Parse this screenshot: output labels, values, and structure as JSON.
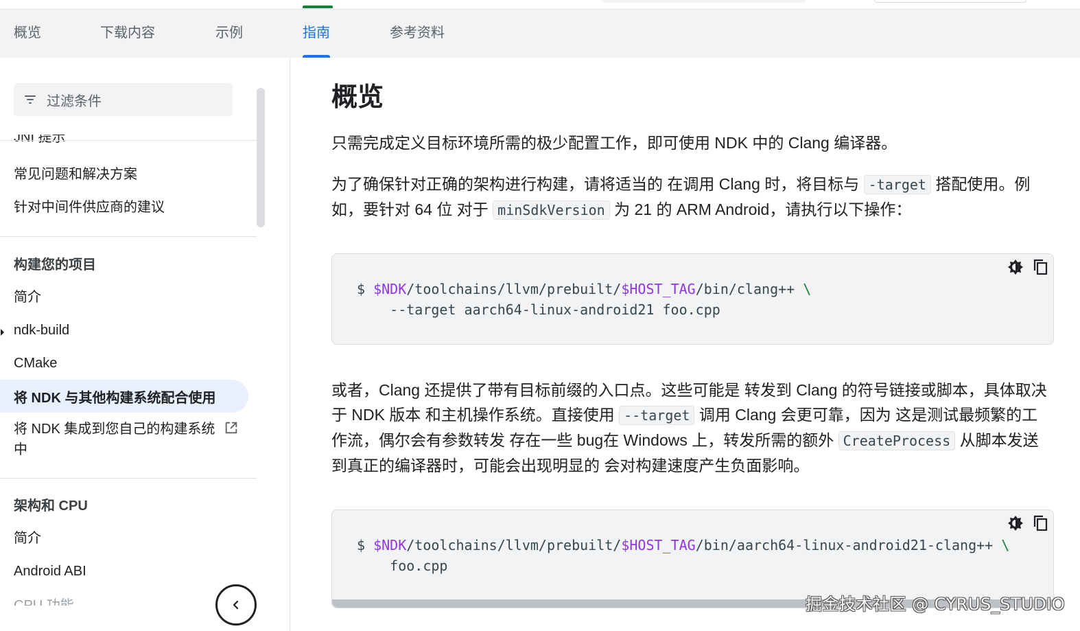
{
  "tabs": [
    {
      "label": "概览"
    },
    {
      "label": "下载内容"
    },
    {
      "label": "示例"
    },
    {
      "label": "指南"
    },
    {
      "label": "参考资料"
    }
  ],
  "active_tab": "指南",
  "sidebar": {
    "filter_label": "过滤条件",
    "cut_item": "JNI 提示",
    "items_top": [
      "常见问题和解决方案",
      "针对中间件供应商的建议"
    ],
    "section1": {
      "heading": "构建您的项目",
      "items": [
        "简介",
        "ndk-build",
        "CMake"
      ],
      "active": "将 NDK 与其他构建系统配合使用",
      "external": "将 NDK 集成到您自己的构建系统中"
    },
    "section2": {
      "heading": "架构和 CPU",
      "items": [
        "简介",
        "Android ABI"
      ],
      "cut_item": "CPU 功能"
    }
  },
  "main": {
    "title": "概览",
    "p1": "只需完成定义目标环境所需的极少配置工作，即可使用 NDK 中的 Clang 编译器。",
    "p2a": "为了确保针对正确的架构进行构建，请将适当的 在调用 Clang 时，将目标与 ",
    "p2code1": "-target",
    "p2b": " 搭配使用。例如，要针对 64 位 对于 ",
    "p2code2": "minSdkVersion",
    "p2c": " 为 21 的 ARM Android，请执行以下操作：",
    "code1": {
      "prompt": "$ ",
      "v1": "$NDK",
      "s1": "/toolchains/llvm/prebuilt/",
      "v2": "$HOST_TAG",
      "s2": "/bin/clang++ ",
      "esc": "\\",
      "line2": "    --target aarch64-linux-android21 foo.cpp"
    },
    "p3a": "或者，Clang 还提供了带有目标前缀的入口点。这些可能是 转发到 Clang 的符号链接或脚本，具体取决于 NDK 版本 和主机操作系统。直接使用 ",
    "p3code1": "--target",
    "p3b": " 调用 Clang 会更可靠，因为 这是测试最频繁的工作流，偶尔会有参数转发 存在一些 bug在 Windows 上，转发所需的额外 ",
    "p3code2": "CreateProcess",
    "p3c": " 从脚本发送到真正的编译器时，可能会出现明显的 会对构建速度产生负面影响。",
    "code2": {
      "prompt": "$ ",
      "v1": "$NDK",
      "s1": "/toolchains/llvm/prebuilt/",
      "v2": "$HOST_TAG",
      "s2": "/bin/aarch64-linux-android21-clang++ ",
      "esc": "\\",
      "line2": "    foo.cpp"
    }
  },
  "watermark": "掘金技术社区 @ CYRUS_STUDIO",
  "colors": {
    "accent": "#1a73e8",
    "code_var": "#9334e6",
    "code_escape": "#188038",
    "tabbar_bg": "#f1f3f4"
  },
  "icons": [
    "filter-icon",
    "external-link-icon",
    "chevron-left-icon",
    "theme-toggle-icon",
    "copy-icon"
  ]
}
